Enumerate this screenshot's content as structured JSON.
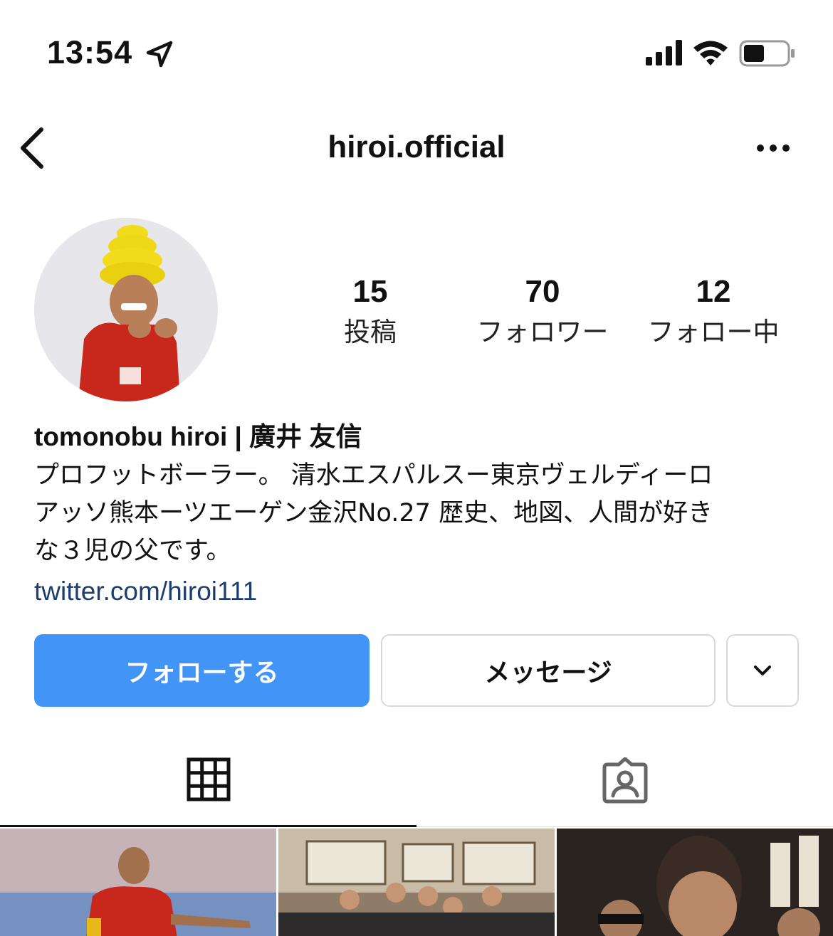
{
  "status_bar": {
    "time": "13:54",
    "icons": [
      "location-arrow-icon",
      "cellular-signal-icon",
      "wifi-icon",
      "battery-icon"
    ]
  },
  "nav": {
    "title": "hiroi.official",
    "back_icon": "chevron-left-icon",
    "more_icon": "ellipsis-icon"
  },
  "stats": [
    {
      "value": "15",
      "label": "投稿"
    },
    {
      "value": "70",
      "label": "フォロワー"
    },
    {
      "value": "12",
      "label": "フォロー中"
    }
  ],
  "bio": {
    "name": "tomonobu hiroi | 廣井 友信",
    "lines": [
      "プロフットボーラー。 清水エスパルスー東京ヴェルディーロ",
      "アッソ熊本ーツエーゲン金沢No.27 歴史、地図、人間が好き",
      "な３児の父です。"
    ],
    "link": "twitter.com/hiroi111"
  },
  "buttons": {
    "follow": "フォローする",
    "message": "メッセージ",
    "more_icon": "chevron-down-icon"
  },
  "tabs": [
    {
      "icon": "grid-icon",
      "active": true
    },
    {
      "icon": "tagged-person-icon",
      "active": false
    }
  ],
  "colors": {
    "follow_button": "#4294f6",
    "link": "#1c3d6e",
    "border": "#d8d8d8"
  }
}
